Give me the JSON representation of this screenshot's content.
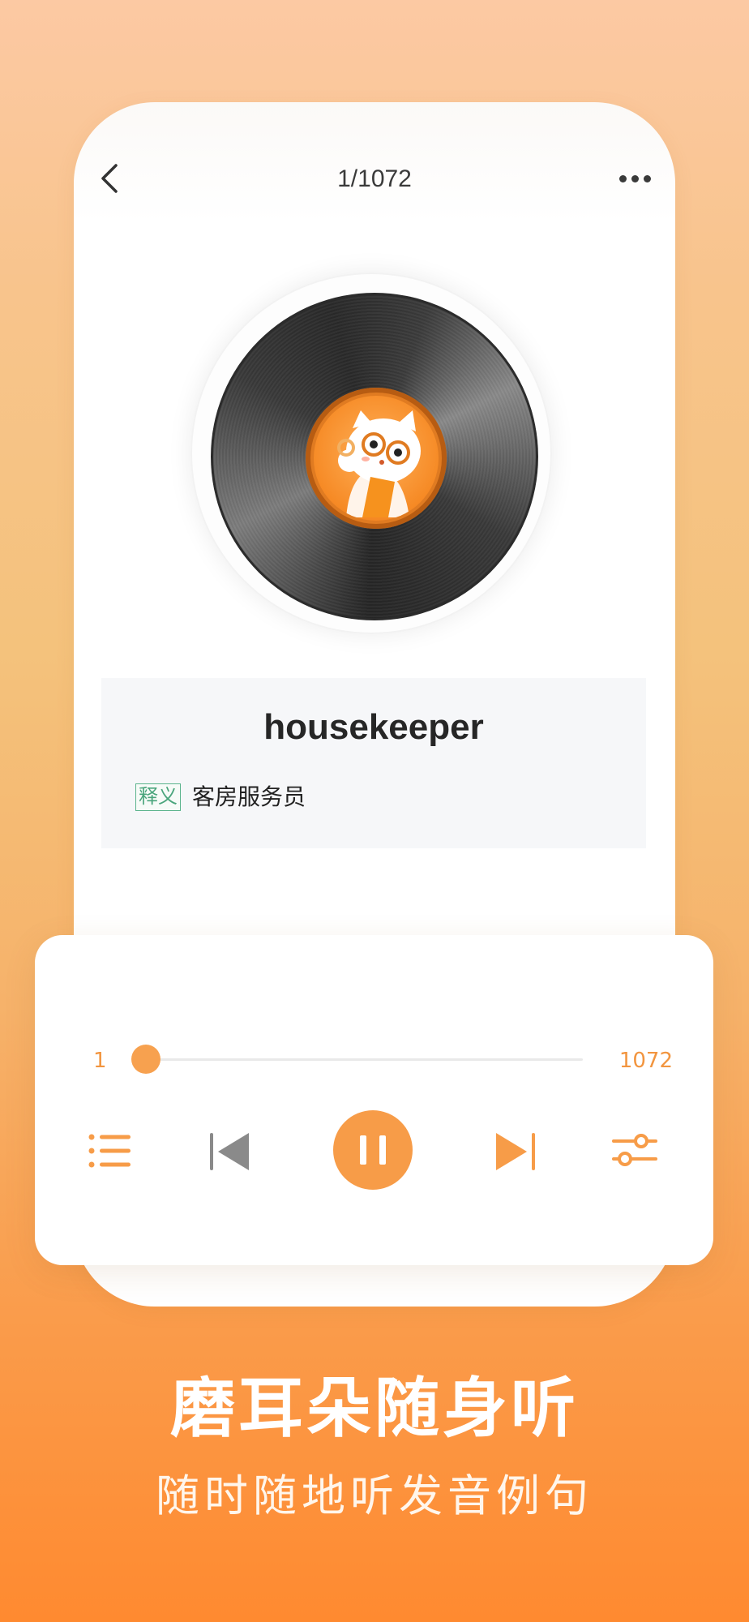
{
  "header": {
    "counter": "1/1072"
  },
  "word_card": {
    "word": "housekeeper",
    "meaning_tag": "释义",
    "meaning": "客房服务员"
  },
  "player": {
    "progress_start": "1",
    "progress_end": "1072",
    "progress_fraction": 0.0,
    "state": "playing",
    "icons": [
      "list-icon",
      "previous-icon",
      "pause-icon",
      "next-icon",
      "settings-sliders-icon"
    ]
  },
  "promo": {
    "headline": "磨耳朵随身听",
    "subline": "随时随地听发音例句"
  },
  "colors": {
    "accent": "#f79c48",
    "tag_green": "#4aa57c",
    "text_dark": "#262626"
  }
}
